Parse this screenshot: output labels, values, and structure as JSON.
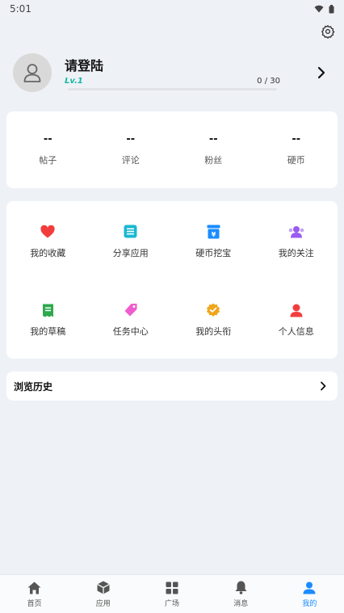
{
  "status_bar": {
    "time": "5:01"
  },
  "profile": {
    "name": "请登陆",
    "level": "Lv.1",
    "progress_text": "0 / 30",
    "progress_fraction": 0
  },
  "stats": [
    {
      "value": "--",
      "label": "帖子"
    },
    {
      "value": "--",
      "label": "评论"
    },
    {
      "value": "--",
      "label": "粉丝"
    },
    {
      "value": "--",
      "label": "硬币"
    }
  ],
  "features": [
    {
      "label": "我的收藏",
      "icon": "heart-icon",
      "color": "#f23d3d"
    },
    {
      "label": "分享应用",
      "icon": "share-app-icon",
      "color": "#1ab8d1"
    },
    {
      "label": "硬币挖宝",
      "icon": "coin-treasure-icon",
      "color": "#1a8cff"
    },
    {
      "label": "我的关注",
      "icon": "follow-icon",
      "color": "#9a5cf0"
    },
    {
      "label": "我的草稿",
      "icon": "draft-icon",
      "color": "#2ea84f"
    },
    {
      "label": "任务中心",
      "icon": "task-tag-icon",
      "color": "#f05ccd"
    },
    {
      "label": "我的头衔",
      "icon": "badge-icon",
      "color": "#f0a51a"
    },
    {
      "label": "个人信息",
      "icon": "person-icon",
      "color": "#f23d3d"
    }
  ],
  "history": {
    "title": "浏览历史"
  },
  "nav": [
    {
      "label": "首页",
      "icon": "home-icon"
    },
    {
      "label": "应用",
      "icon": "cube-icon"
    },
    {
      "label": "广场",
      "icon": "grid-icon"
    },
    {
      "label": "消息",
      "icon": "bell-icon"
    },
    {
      "label": "我的",
      "icon": "profile-icon",
      "active": true
    }
  ],
  "colors": {
    "accent": "#1a8cff",
    "level": "#13b5a0",
    "background": "#eef1f6"
  }
}
